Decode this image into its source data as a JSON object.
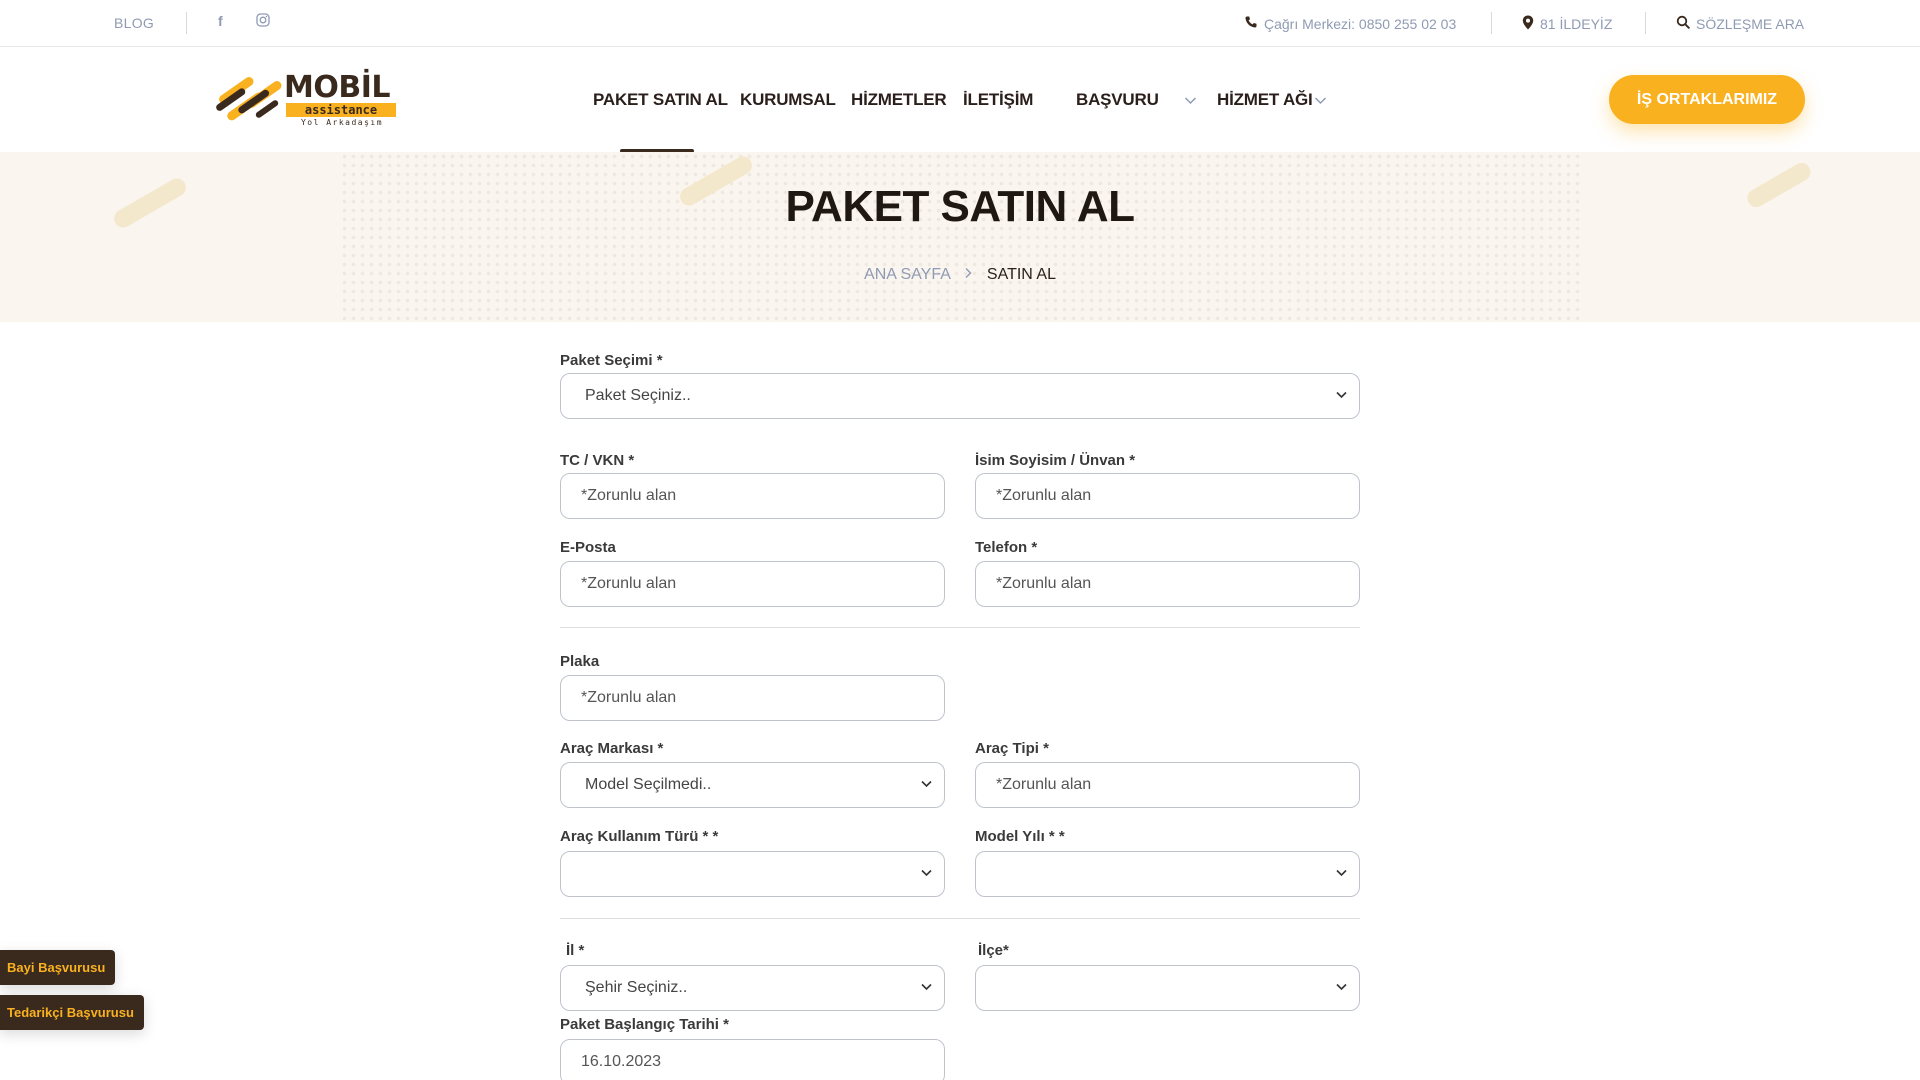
{
  "topbar": {
    "blog": "BLOG",
    "icons": [
      "facebook-icon",
      "instagram-icon"
    ],
    "call_center": "Çağrı Merkezi: 0850 255 02 03",
    "locations": "81 İLDEYİZ",
    "search": "SÖZLEŞME ARA"
  },
  "logo": {
    "word": "MOBİL",
    "sub": "assistance",
    "tagline": "Yol Arkadaşım"
  },
  "nav": {
    "items": [
      "PAKET SATIN AL",
      "KURUMSAL",
      "HİZMETLER",
      "İLETİŞİM",
      "BAŞVURU",
      "HİZMET AĞI"
    ],
    "partner_button": "İŞ ORTAKLARIMIZ"
  },
  "hero": {
    "title": "PAKET SATIN AL",
    "breadcrumb_home": "ANA SAYFA",
    "breadcrumb_current": "SATIN AL"
  },
  "form": {
    "package_label": "Paket Seçimi *",
    "package_value": "Paket Seçiniz..",
    "tc_label": "TC / VKN *",
    "name_label": "İsim Soyisim / Ünvan *",
    "email_label": "E-Posta",
    "phone_label": "Telefon *",
    "plate_label": "Plaka",
    "brand_label": "Araç Markası *",
    "brand_value": "Model Seçilmedi..",
    "type_label": "Araç Tipi *",
    "usage_label": "Araç Kullanım Türü * *",
    "year_label": "Model Yılı * *",
    "city_label": "İl *",
    "city_value": "Şehir Seçiniz..",
    "district_label": "İlçe*",
    "start_label": "Paket Başlangıç Tarihi *",
    "start_value": "16.10.2023",
    "required_placeholder": "*Zorunlu alan"
  },
  "side_buttons": {
    "dealer": "Bayi Başvurusu",
    "supplier": "Tedarikçi Başvurusu"
  },
  "colors": {
    "accent": "#f9b11f",
    "brand_dark": "#3a2a1e",
    "muted": "#8f9bb3",
    "hero_bg": "#faf5ef"
  }
}
